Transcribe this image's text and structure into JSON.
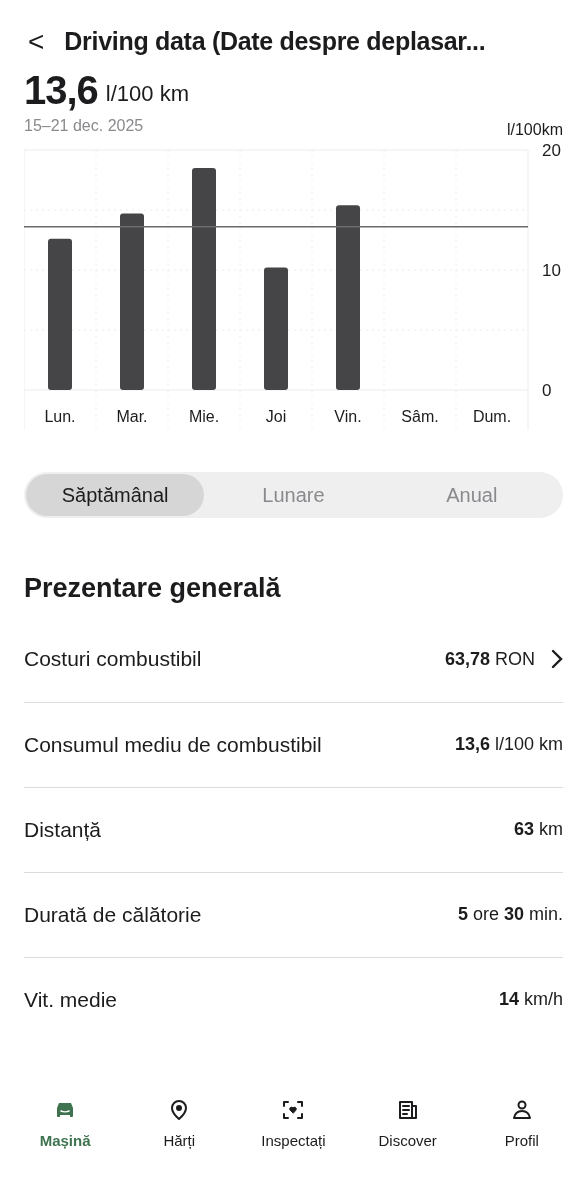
{
  "header": {
    "back": "<",
    "title": "Driving data (Date despre deplasar..."
  },
  "summary": {
    "value": "13,6",
    "unit": "l/100 km",
    "period": "15–21 dec. 2025"
  },
  "chart_data": {
    "type": "bar",
    "ylabel": "l/100km",
    "categories": [
      "Lun.",
      "Mar.",
      "Mie.",
      "Joi",
      "Vin.",
      "Sâm.",
      "Dum."
    ],
    "series": [
      {
        "color": "#454547",
        "values": [
          12.6,
          14.7,
          18.5,
          10.2,
          15.4,
          null,
          null
        ]
      }
    ],
    "ylim": [
      0,
      20
    ],
    "yticks": [
      0,
      10,
      20
    ],
    "ref_lines": [
      {
        "axis": "y",
        "value": 13.6
      }
    ]
  },
  "periods": [
    {
      "label": "Săptămânal",
      "selected": true
    },
    {
      "label": "Lunare",
      "selected": false
    },
    {
      "label": "Anual",
      "selected": false
    }
  ],
  "overview": {
    "title": "Prezentare generală",
    "rows": [
      {
        "kind": "link",
        "label": "Costuri combustibil",
        "value": "**63,78** RON"
      },
      {
        "kind": "plain",
        "label": "Consumul mediu de combustibil",
        "value": "**13,6** l/100 km"
      },
      {
        "kind": "plain",
        "label": "Distanță",
        "value": "**63** km"
      },
      {
        "kind": "plain",
        "label": "Durată de călătorie",
        "value": "**5** ore **30** min."
      },
      {
        "kind": "plain",
        "label": "Vit. medie",
        "value": "**14** km/h"
      }
    ]
  },
  "nav": [
    {
      "kind": "car",
      "label": "Mașină",
      "selected": true
    },
    {
      "kind": "pin",
      "label": "Hărți",
      "selected": false
    },
    {
      "kind": "scan",
      "label": "Inspectați",
      "selected": false
    },
    {
      "kind": "news",
      "label": "Discover",
      "selected": false
    },
    {
      "kind": "person",
      "label": "Profil",
      "selected": false
    }
  ]
}
